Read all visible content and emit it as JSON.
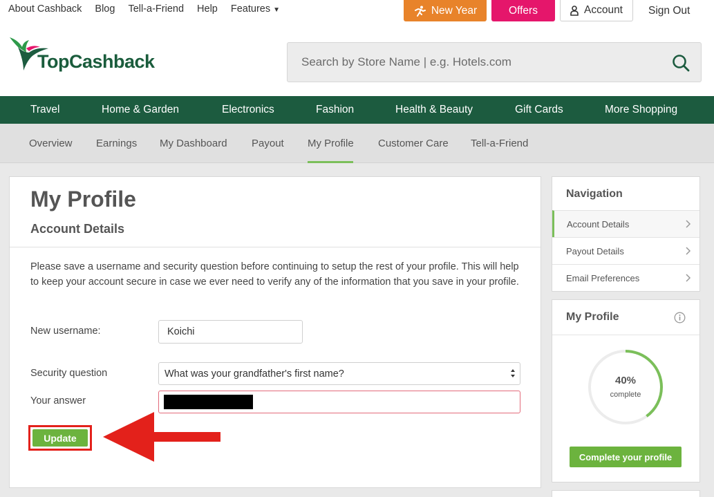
{
  "toplinks": {
    "about": "About Cashback",
    "blog": "Blog",
    "tell": "Tell-a-Friend",
    "help": "Help",
    "features": "Features"
  },
  "header": {
    "new_year": "New Year",
    "offers": "Offers",
    "account": "Account",
    "sign_out": "Sign Out",
    "logo_text": "TopCashback",
    "search_placeholder": "Search by Store Name | e.g. Hotels.com"
  },
  "categories": [
    "Travel",
    "Home & Garden",
    "Electronics",
    "Fashion",
    "Health & Beauty",
    "Gift Cards",
    "More Shopping"
  ],
  "subnav": [
    "Overview",
    "Earnings",
    "My Dashboard",
    "Payout",
    "My Profile",
    "Customer Care",
    "Tell-a-Friend"
  ],
  "subnav_active": "My Profile",
  "main": {
    "title": "My Profile",
    "section": "Account Details",
    "intro": "Please save a username and security question before continuing to setup the rest of your profile. This will help to keep your account secure in case we ever need to verify any of the information that you save in your profile.",
    "username_label": "New username:",
    "username_value": "Koichi",
    "security_label": "Security question",
    "security_value": "What was your grandfather's first name?",
    "answer_label": "Your answer",
    "update_label": "Update"
  },
  "sidebar": {
    "nav_title": "Navigation",
    "items": [
      "Account Details",
      "Payout Details",
      "Email Preferences"
    ],
    "profile_title": "My Profile",
    "percent": "40%",
    "percent_value": 0.4,
    "percent_sub": "complete",
    "complete_btn": "Complete your profile"
  },
  "colors": {
    "brand_green": "#1c5b3f",
    "accent_green": "#6cb33e",
    "orange": "#e8832a",
    "pink": "#e5166b",
    "annotation_red": "#e3211b"
  }
}
